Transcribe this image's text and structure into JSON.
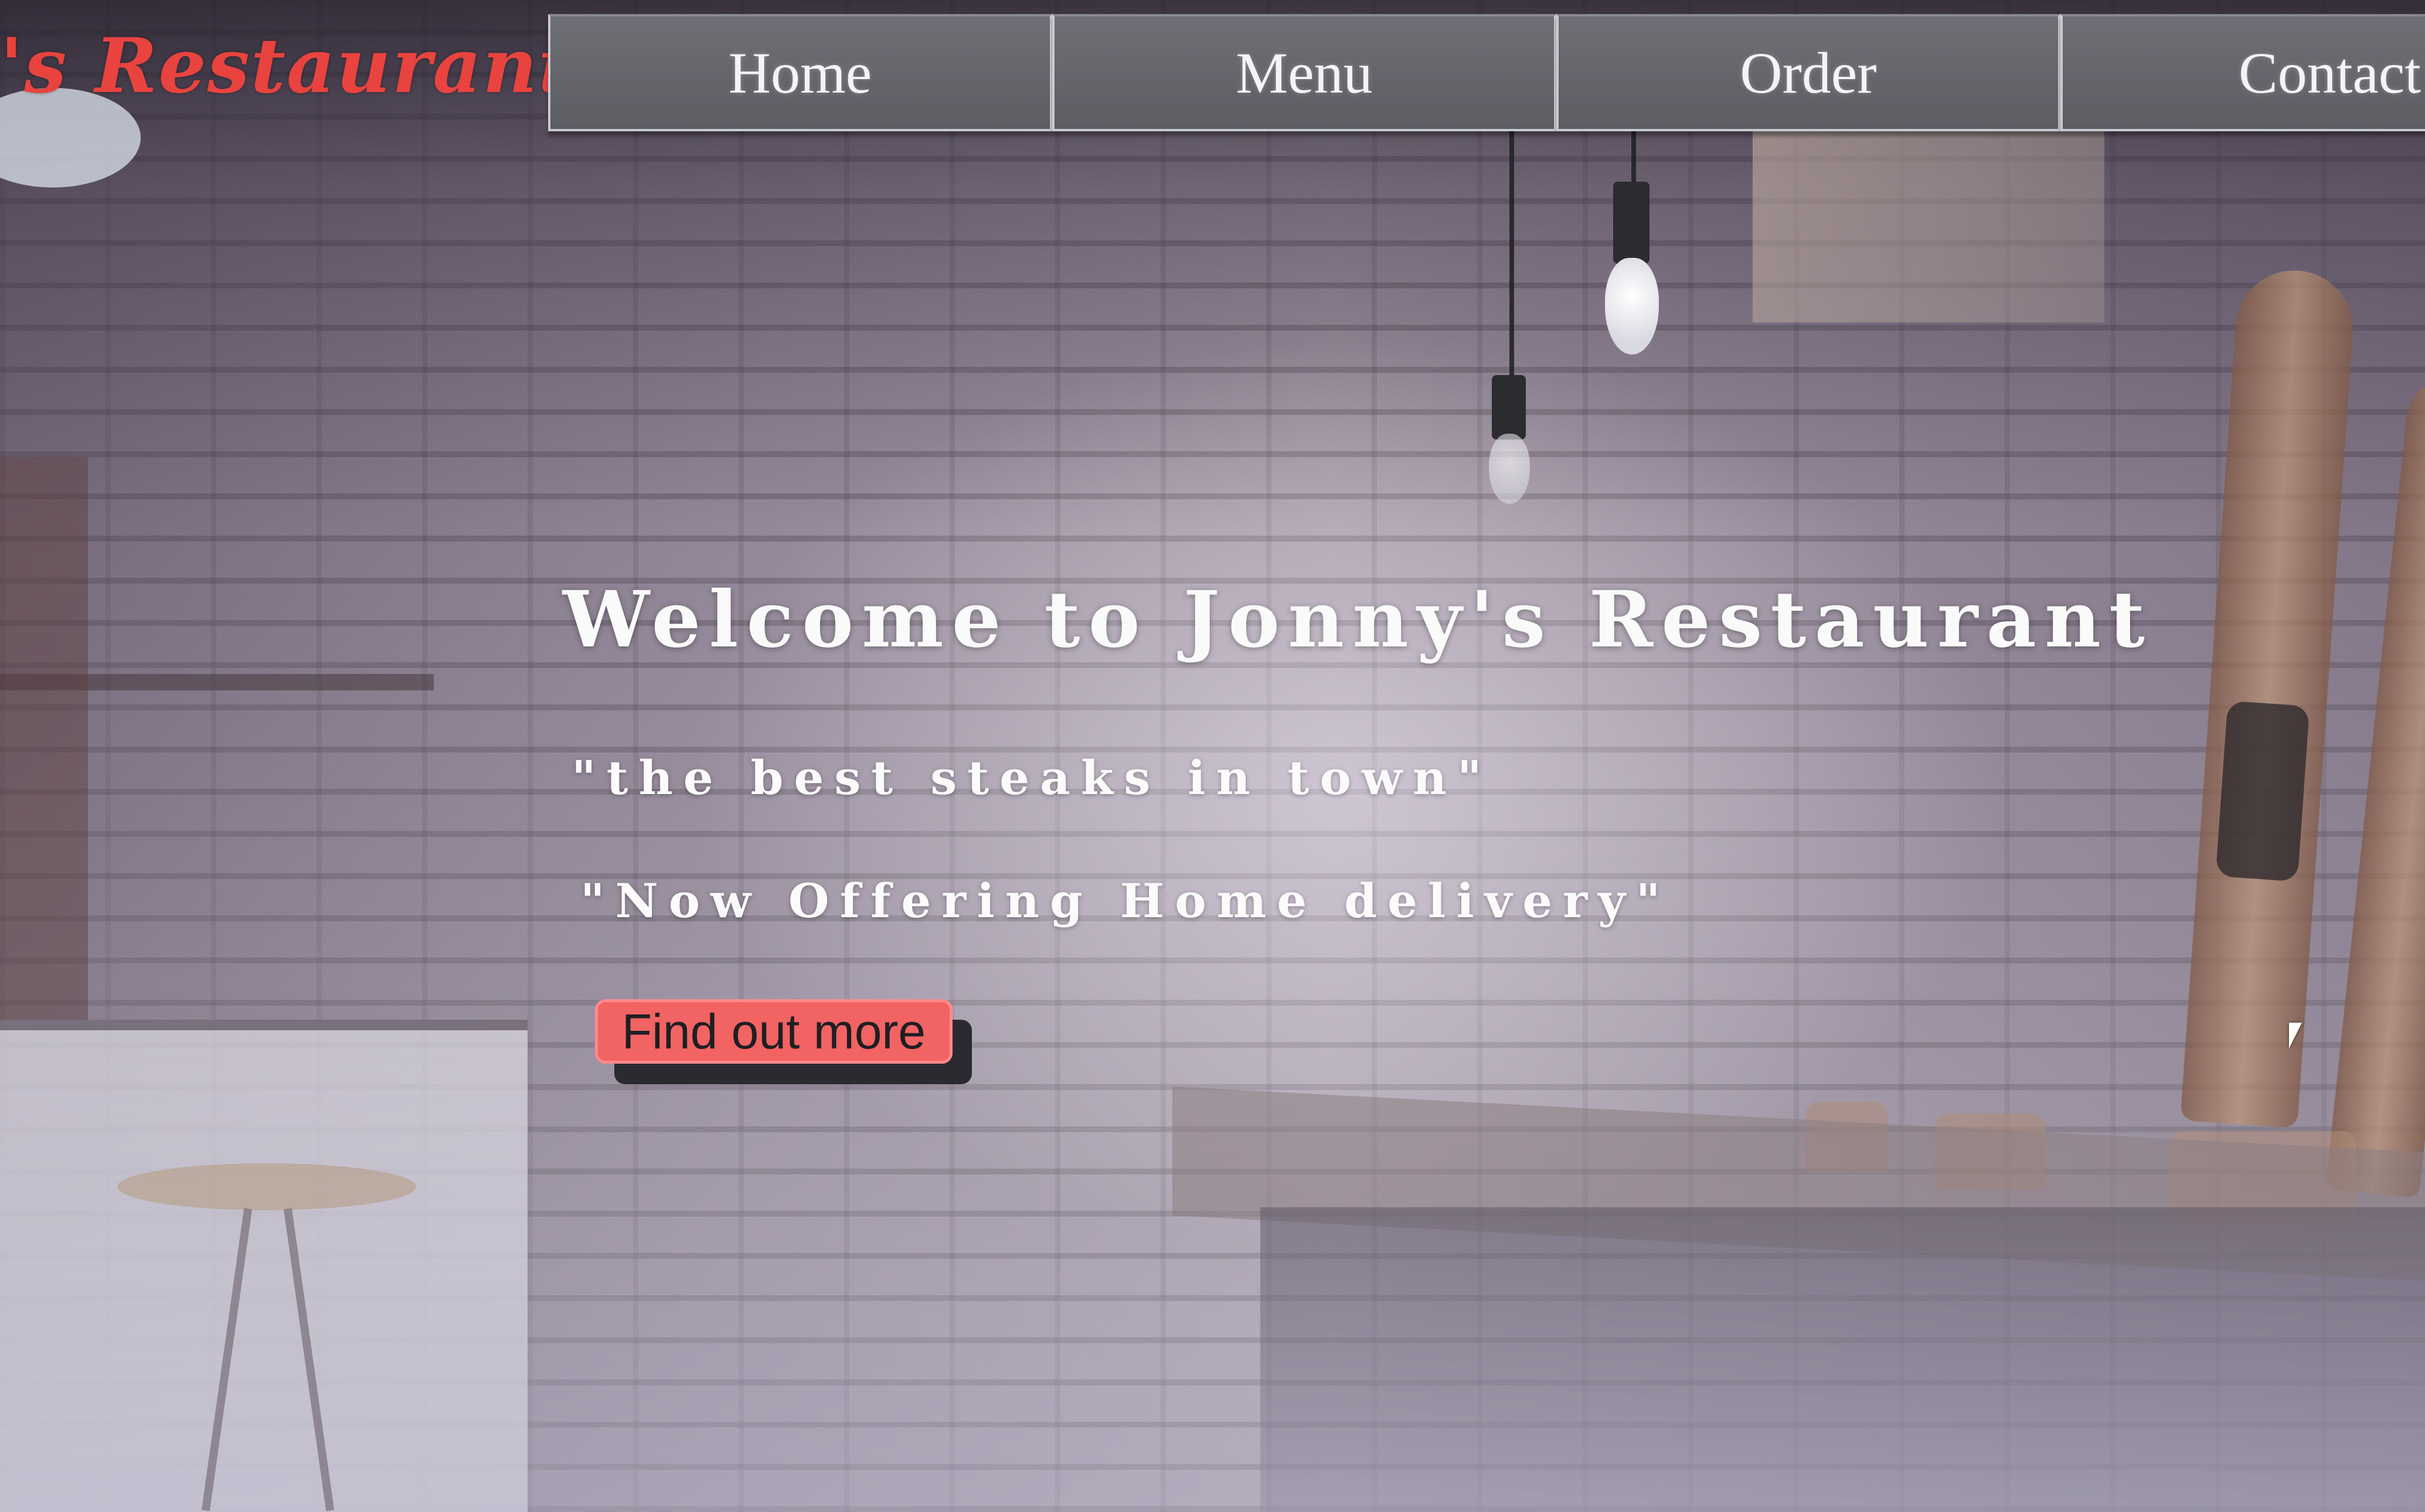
{
  "brand": {
    "name": "'s Restaurant"
  },
  "nav": {
    "items": [
      {
        "label": "Home"
      },
      {
        "label": "Menu"
      },
      {
        "label": "Order"
      },
      {
        "label": "Contact"
      }
    ]
  },
  "hero": {
    "title": "Welcome to Jonny's Restaurant",
    "tagline": "\"the best steaks in town\"",
    "announcement": "\"Now Offering Home delivery\"",
    "cta_label": "Find out more"
  },
  "colors": {
    "brand_red": "#e8433f",
    "nav_bg": "#66666d",
    "cta_bg": "#f26363",
    "hero_text": "#fafafa"
  },
  "icons": {
    "cursor": "mouse-pointer-icon"
  }
}
